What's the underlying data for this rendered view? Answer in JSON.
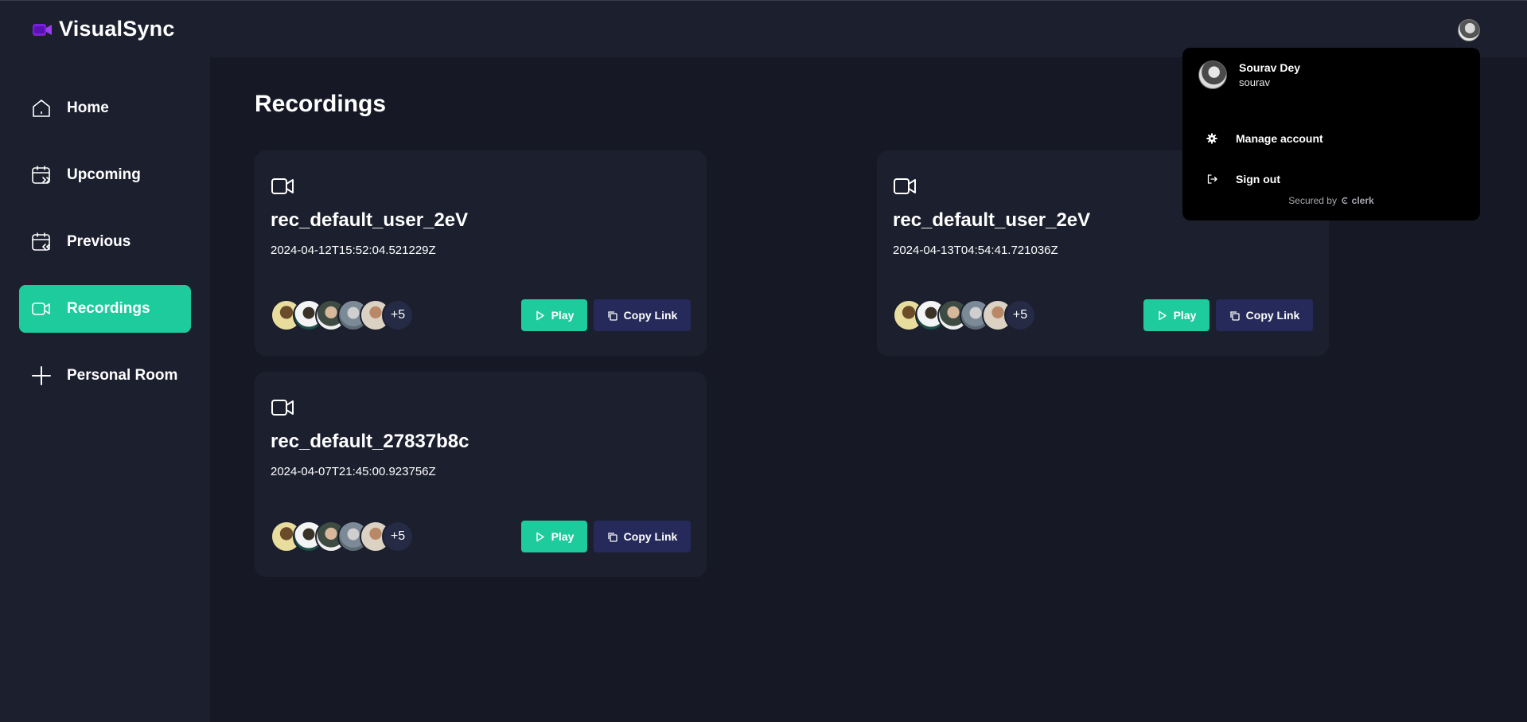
{
  "app": {
    "name": "VisualSync"
  },
  "sidebar": {
    "items": [
      {
        "label": "Home",
        "icon": "home-icon"
      },
      {
        "label": "Upcoming",
        "icon": "calendar-upcoming-icon"
      },
      {
        "label": "Previous",
        "icon": "calendar-previous-icon"
      },
      {
        "label": "Recordings",
        "icon": "video-icon",
        "active": true
      },
      {
        "label": "Personal Room",
        "icon": "plus-icon"
      }
    ]
  },
  "main": {
    "title": "Recordings",
    "cards": [
      {
        "title": "rec_default_user_2eV",
        "date": "2024-04-12T15:52:04.521229Z",
        "more": "+5",
        "play": "Play",
        "copy": "Copy Link"
      },
      {
        "title": "rec_default_user_2eV",
        "date": "2024-04-13T04:54:41.721036Z",
        "more": "+5",
        "play": "Play",
        "copy": "Copy Link"
      },
      {
        "title": "rec_default_27837b8c",
        "date": "2024-04-07T21:45:00.923756Z",
        "more": "+5",
        "play": "Play",
        "copy": "Copy Link"
      }
    ]
  },
  "user_menu": {
    "name": "Sourav Dey",
    "username": "sourav",
    "manage_label": "Manage account",
    "signout_label": "Sign out",
    "secured_by": "Secured by",
    "provider": "clerk"
  },
  "colors": {
    "accent": "#1ecb9c",
    "copy_button": "#252a5a",
    "surface": "#1c1f2e",
    "background": "#161925"
  }
}
